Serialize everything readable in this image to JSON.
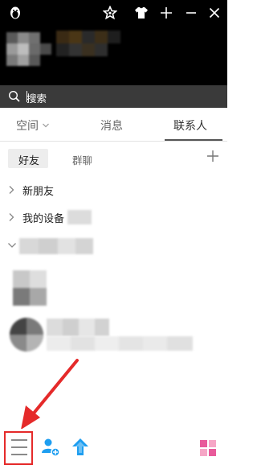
{
  "search": {
    "placeholder": "搜索"
  },
  "tabs": [
    {
      "label": "空间"
    },
    {
      "label": "消息"
    },
    {
      "label": "联系人"
    }
  ],
  "subtabs": {
    "friends": "好友",
    "groups": "群聊"
  },
  "contacts": {
    "groups": [
      {
        "label": "新朋友"
      },
      {
        "label": "我的设备"
      }
    ]
  },
  "colors": {
    "header_bg": "#000000",
    "search_bg": "#3a3a3a",
    "accent_blue": "#1e9ef0",
    "highlight_red": "#e52a2a",
    "pink": "#e85a9a"
  },
  "icons": {
    "app_logo": "penguin-icon",
    "skin": "shirt-icon",
    "star": "star-icon",
    "add": "plus-icon",
    "minimize": "minimize-icon",
    "close": "close-icon",
    "search": "search-icon",
    "menu": "menu-icon",
    "add_friend": "add-friend-icon",
    "upload": "upload-icon",
    "apps": "apps-grid-icon"
  }
}
